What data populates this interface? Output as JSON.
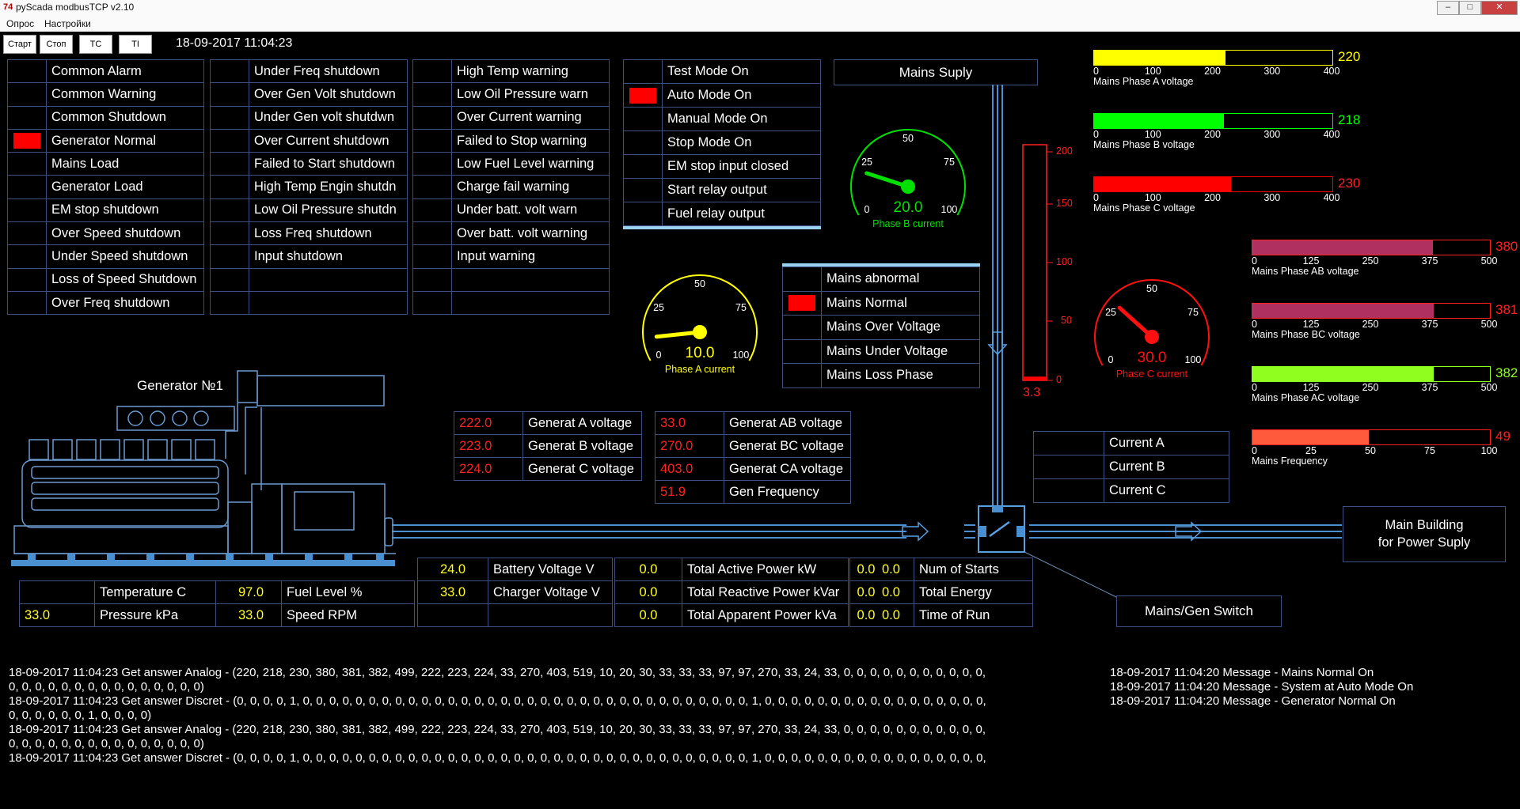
{
  "window": {
    "title": "pyScada modbusTCP v2.10",
    "app_icon": "74"
  },
  "menu": {
    "items": [
      "Опрос",
      "Настройки"
    ]
  },
  "toolbar": {
    "buttons": [
      "Старт",
      "Стоп",
      "TC",
      "TI"
    ],
    "datetime": "18-09-2017 11:04:23"
  },
  "alarms": {
    "col1": [
      "Common Alarm",
      "Common Warning",
      "Common Shutdown",
      "Generator Normal",
      "Mains Load",
      "Generator Load",
      "EM stop shutdown",
      "Over Speed shutdown",
      "Under Speed shutdown",
      "Loss of Speed Shutdown",
      "Over Freq shutdown"
    ],
    "col1_active": [
      false,
      false,
      false,
      true,
      false,
      false,
      false,
      false,
      false,
      false,
      false
    ],
    "col2": [
      "Under Freq shutdown",
      "Over Gen Volt shutdown",
      "Under Gen volt shutdwn",
      "Over Current shutdown",
      "Failed to Start shutdown",
      "High Temp Engin shutdn",
      "Low Oil Pressure shutdn",
      "Loss Freq shutdown",
      "Input shutdown",
      "",
      ""
    ],
    "col3": [
      "High Temp warning",
      "Low Oil Pressure warn",
      "Over Current warning",
      "Failed to Stop warning",
      "Low Fuel Level warning",
      "Charge fail warning",
      "Under batt. volt warn",
      "Over batt. volt warning",
      "Input warning",
      "",
      ""
    ],
    "col4": [
      "Test Mode On",
      "Auto Mode On",
      "Manual Mode On",
      "Stop Mode On",
      "EM stop input closed",
      "Start relay output",
      "Fuel relay output"
    ],
    "col4_active": [
      false,
      true,
      false,
      false,
      false,
      false,
      false
    ]
  },
  "mains_status": {
    "items": [
      "Mains abnormal",
      "Mains Normal",
      "Mains Over Voltage",
      "Mains Under Voltage",
      "Mains Loss Phase"
    ],
    "active": [
      false,
      true,
      false,
      false,
      false
    ]
  },
  "gauges": [
    {
      "name": "phase-a",
      "value": "10.0",
      "label": "Phase A current",
      "color": "#ffff00",
      "ticks": [
        "0",
        "25",
        "50",
        "75",
        "100"
      ],
      "level": 10
    },
    {
      "name": "phase-b",
      "value": "20.0",
      "label": "Phase B current",
      "color": "#00e000",
      "ticks": [
        "0",
        "25",
        "50",
        "75",
        "100"
      ],
      "level": 20
    },
    {
      "name": "phase-c",
      "value": "30.0",
      "label": "Phase C current",
      "color": "#ff1010",
      "ticks": [
        "0",
        "25",
        "50",
        "75",
        "100"
      ],
      "level": 30
    }
  ],
  "vertical_meter": {
    "ticks": [
      "200",
      "150",
      "100",
      "50",
      "0"
    ],
    "value": "3.3",
    "level": 3.3,
    "max": 200
  },
  "bars": [
    {
      "label": "Mains Phase A voltage",
      "value": "220",
      "level": 220,
      "max": 400,
      "ticks": [
        "0",
        "100",
        "200",
        "300",
        "400"
      ],
      "color": "#ffff00",
      "frame": "#ffff00",
      "vcolor": "#ffff00"
    },
    {
      "label": "Mains Phase B voltage",
      "value": "218",
      "level": 218,
      "max": 400,
      "ticks": [
        "0",
        "100",
        "200",
        "300",
        "400"
      ],
      "color": "#00ff00",
      "frame": "#00ff00",
      "vcolor": "#00ff00"
    },
    {
      "label": "Mains Phase C voltage",
      "value": "230",
      "level": 230,
      "max": 400,
      "ticks": [
        "0",
        "100",
        "200",
        "300",
        "400"
      ],
      "color": "#ff0000",
      "frame": "#ff0000",
      "vcolor": "#ff2020"
    },
    {
      "label": "Mains Phase AB voltage",
      "value": "380",
      "level": 380,
      "max": 500,
      "ticks": [
        "0",
        "125",
        "250",
        "375",
        "500"
      ],
      "color": "#b03060",
      "frame": "#ff2020",
      "vcolor": "#ff2020"
    },
    {
      "label": "Mains Phase BC voltage",
      "value": "381",
      "level": 381,
      "max": 500,
      "ticks": [
        "0",
        "125",
        "250",
        "375",
        "500"
      ],
      "color": "#b03060",
      "frame": "#ff2020",
      "vcolor": "#ff2020"
    },
    {
      "label": "Mains Phase AC voltage",
      "value": "382",
      "level": 382,
      "max": 500,
      "ticks": [
        "0",
        "125",
        "250",
        "375",
        "500"
      ],
      "color": "#90ff20",
      "frame": "#90ff20",
      "vcolor": "#90ff20"
    },
    {
      "label": "Mains Frequency",
      "value": "49",
      "level": 49,
      "max": 100,
      "ticks": [
        "0",
        "25",
        "50",
        "75",
        "100"
      ],
      "color": "#ff5a3c",
      "frame": "#ff2020",
      "vcolor": "#ff2020"
    }
  ],
  "labels": {
    "mains_supply": "Mains Suply",
    "generator": "Generator №1",
    "main_building_1": "Main Building",
    "main_building_2": "for Power Suply",
    "switch": "Mains/Gen Switch"
  },
  "gen_voltages": [
    {
      "value": "222.0",
      "label": "Generat A voltage"
    },
    {
      "value": "223.0",
      "label": "Generat B voltage"
    },
    {
      "value": "224.0",
      "label": "Generat C voltage"
    }
  ],
  "gen_line": [
    {
      "value": "33.0",
      "label": "Generat AB voltage"
    },
    {
      "value": "270.0",
      "label": "Generat BC voltage"
    },
    {
      "value": "403.0",
      "label": "Generat CA voltage"
    },
    {
      "value": "51.9",
      "label": "Gen Frequency"
    }
  ],
  "currents": [
    "Current A",
    "Current B",
    "Current C"
  ],
  "engine": [
    {
      "v1": "",
      "l1": "Temperature C",
      "v2": "97.0",
      "l2": "Fuel Level %"
    },
    {
      "v1": "33.0",
      "l1": "Pressure kPa",
      "v2": "33.0",
      "l2": "Speed RPM"
    }
  ],
  "battery": [
    {
      "v": "24.0",
      "l": "Battery Voltage V"
    },
    {
      "v": "33.0",
      "l": "Charger Voltage V"
    },
    {
      "v": "",
      "l": ""
    }
  ],
  "power": [
    {
      "v": "0.0",
      "l": "Total Active Power  kW"
    },
    {
      "v": "0.0",
      "l": "Total Reactive Power kVar"
    },
    {
      "v": "0.0",
      "l": "Total Apparent Power kVa"
    }
  ],
  "counters": [
    {
      "a": "0.0",
      "b": "0.0",
      "l": "Num of Starts"
    },
    {
      "a": "0.0",
      "b": "0.0",
      "l": "Total Energy"
    },
    {
      "a": "0.0",
      "b": "0.0",
      "l": "Time of Run"
    }
  ],
  "log_lines": [
    "18-09-2017 11:04:23 Get answer Analog - (220, 218, 230, 380, 381, 382, 499, 222, 223, 224, 33, 270, 403, 519, 10, 20, 30, 33, 33, 33, 97, 97, 270, 33, 24, 33, 0, 0, 0, 0, 0, 0, 0, 0, 0, 0, 0,",
    "0, 0, 0, 0, 0, 0, 0, 0, 0, 0, 0, 0, 0, 0, 0)",
    "18-09-2017 11:04:23 Get answer Discret - (0, 0, 0, 0, 1, 0, 0, 0, 0, 0, 0, 0, 0, 0, 0, 0, 0, 0, 0, 0, 0, 0, 0, 0, 0, 0, 0, 0, 0, 0, 0, 0, 0, 0, 0, 0, 0, 0, 0, 1, 0, 0, 0, 0, 0, 0, 0, 0, 0, 0, 0, 0, 0, 0, 0, 0, 0,",
    "0, 0, 0, 0, 0, 0, 1, 0, 0, 0, 0)",
    "18-09-2017 11:04:23 Get answer Analog - (220, 218, 230, 380, 381, 382, 499, 222, 223, 224, 33, 270, 403, 519, 10, 20, 30, 33, 33, 33, 97, 97, 270, 33, 24, 33, 0, 0, 0, 0, 0, 0, 0, 0, 0, 0, 0,",
    "0, 0, 0, 0, 0, 0, 0, 0, 0, 0, 0, 0, 0, 0, 0)",
    "18-09-2017 11:04:23 Get answer Discret - (0, 0, 0, 0, 1, 0, 0, 0, 0, 0, 0, 0, 0, 0, 0, 0, 0, 0, 0, 0, 0, 0, 0, 0, 0, 0, 0, 0, 0, 0, 0, 0, 0, 0, 0, 0, 0, 0, 0, 1, 0, 0, 0, 0, 0, 0, 0, 0, 0, 0, 0, 0, 0, 0, 0, 0, 0,"
  ],
  "messages": [
    "18-09-2017 11:04:20 Message - Mains Normal On",
    "18-09-2017 11:04:20 Message - System at Auto Mode On",
    "18-09-2017 11:04:20 Message - Generator Normal On"
  ],
  "colors": {
    "pipe": "#4a90d0",
    "frame": "#3b4f80"
  }
}
